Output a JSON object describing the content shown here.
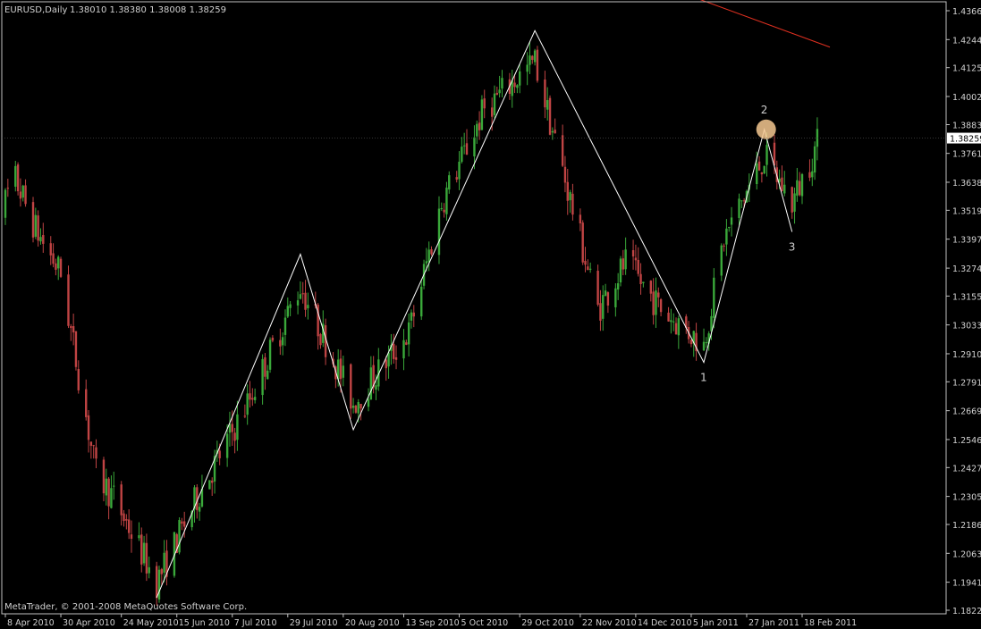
{
  "header": {
    "symbol": "EURUSD,Daily",
    "ohlc": "1.38010 1.38380 1.38008 1.38259"
  },
  "copyright": "MetaTrader, © 2001-2008 MetaQuotes Software Corp.",
  "colors": {
    "background": "#000000",
    "grid_frame": "#c0c0c0",
    "bull_candle": "#3aa83a",
    "bear_candle": "#c04444",
    "zigzag": "#ffffff",
    "trendline": "#e03020",
    "marker": "#f5c890",
    "text": "#d0d0d0"
  },
  "chart_data": {
    "type": "candlestick",
    "symbol": "EURUSD",
    "timeframe": "Daily",
    "last_price": "1.38259",
    "y_ticks": [
      "1.43665",
      "1.42440",
      "1.41250",
      "1.40025",
      "1.38830",
      "1.37610",
      "1.36385",
      "1.35195",
      "1.33970",
      "1.32740",
      "1.31555",
      "1.30330",
      "1.29105",
      "1.27915",
      "1.26690",
      "1.25465",
      "1.24275",
      "1.23050",
      "1.21860",
      "1.20635",
      "1.19410",
      "1.18220"
    ],
    "x_ticks": [
      "8 Apr 2010",
      "30 Apr 2010",
      "24 May 2010",
      "15 Jun 2010",
      "7 Jul 2010",
      "29 Jul 2010",
      "20 Aug 2010",
      "13 Sep 2010",
      "5 Oct 2010",
      "29 Oct 2010",
      "22 Nov 2010",
      "14 Dec 2010",
      "5 Jan 2011",
      "27 Jan 2011",
      "18 Feb 2011"
    ],
    "ylim": [
      1.1822,
      1.43665
    ],
    "zigzag": [
      {
        "date": "7 Jun 2010",
        "price": 1.1876
      },
      {
        "date": "3 Aug 2010",
        "price": 1.3333
      },
      {
        "date": "24 Aug 2010",
        "price": 1.2588
      },
      {
        "date": "4 Nov 2010",
        "price": 1.4282
      },
      {
        "date": "10 Jan 2011",
        "price": 1.2874
      },
      {
        "date": "3 Feb 2011",
        "price": 1.3863
      },
      {
        "date": "14 Feb 2011",
        "price": 1.3428
      }
    ],
    "wave_labels": [
      {
        "label": "1",
        "date": "10 Jan 2011",
        "price": 1.2874
      },
      {
        "label": "2",
        "date": "3 Feb 2011",
        "price": 1.3863
      },
      {
        "label": "3",
        "date": "14 Feb 2011",
        "price": 1.3428
      }
    ],
    "trendline": [
      {
        "date": "7 Jan 2011",
        "price": 1.442
      },
      {
        "date": "1 Mar 2011",
        "price": 1.4212
      }
    ]
  }
}
